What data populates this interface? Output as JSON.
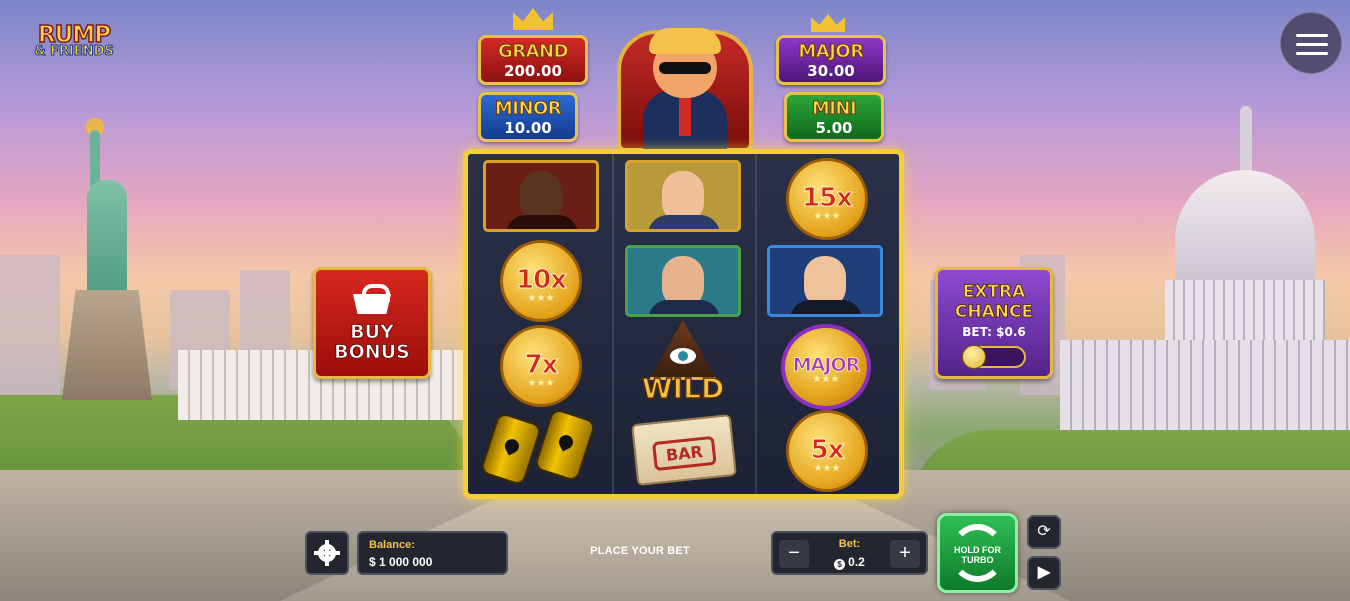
{
  "logo": {
    "line1": "RUMP",
    "line2": "& FRIENDS"
  },
  "menu": {
    "icon": "hamburger-icon"
  },
  "jackpots": [
    {
      "name": "GRAND",
      "value": "200.00",
      "color": "#c8211c"
    },
    {
      "name": "MAJOR",
      "value": "30.00",
      "color": "#7a2cb3"
    },
    {
      "name": "MINOR",
      "value": "10.00",
      "color": "#2258c2"
    },
    {
      "name": "MINI",
      "value": "5.00",
      "color": "#1f8f2f"
    }
  ],
  "reels": {
    "columns": [
      [
        "portrait-sunglasses-man",
        "coin-10x",
        "coin-7x",
        "oil-barrels"
      ],
      [
        "portrait-elder-man",
        "portrait-gray-hair-man",
        "wild-pyramid",
        "bar-folder"
      ],
      [
        "coin-15x",
        "portrait-young-man",
        "coin-major",
        "coin-5x"
      ]
    ],
    "coins": {
      "c10": "10x",
      "c7": "7x",
      "c15": "15x",
      "cmajor": "MAJOR",
      "c5": "5x"
    },
    "wild_label": "WILD",
    "bar_label": "BAR"
  },
  "buy_bonus": {
    "line1": "BUY",
    "line2": "BONUS",
    "icon": "basket-icon"
  },
  "extra_chance": {
    "line1": "EXTRA",
    "line2": "CHANCE",
    "bet": "BET: $0.6",
    "enabled": false
  },
  "bottom_bar": {
    "balance_label": "Balance:",
    "balance_value": "$ 1 000 000",
    "status": "PLACE YOUR BET",
    "bet_label": "Bet:",
    "bet_value": "0.2",
    "spin_label_1": "HOLD FOR",
    "spin_label_2": "TURBO",
    "minus": "−",
    "plus": "+",
    "autoplay_glyph": "⟳",
    "fast_glyph": "▶"
  }
}
